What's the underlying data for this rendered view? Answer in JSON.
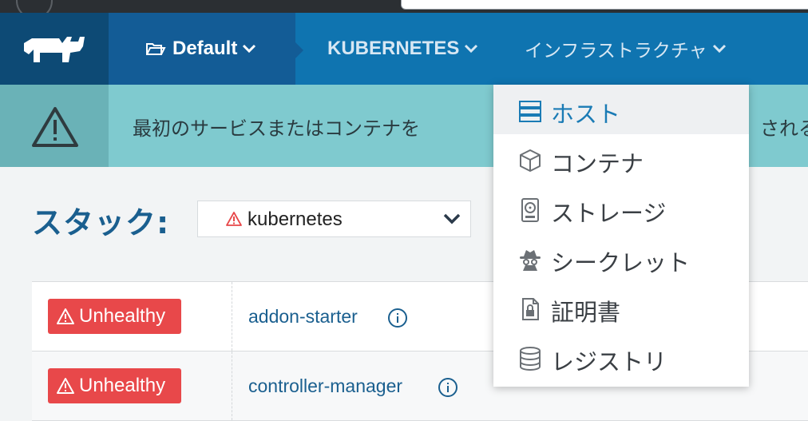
{
  "nav": {
    "environment": "Default",
    "kubernetes": "KUBERNETES",
    "infrastructure": "インフラストラクチャ"
  },
  "banner": {
    "text_left": "最初のサービスまたはコンテナを",
    "text_right": "される"
  },
  "stack": {
    "label": "スタック:",
    "selected": "kubernetes"
  },
  "services": [
    {
      "status": "Unhealthy",
      "name": "addon-starter"
    },
    {
      "status": "Unhealthy",
      "name": "controller-manager"
    }
  ],
  "menu": {
    "items": [
      {
        "label": "ホスト",
        "icon": "server-icon"
      },
      {
        "label": "コンテナ",
        "icon": "cube-icon"
      },
      {
        "label": "ストレージ",
        "icon": "storage-icon"
      },
      {
        "label": "シークレット",
        "icon": "spy-icon"
      },
      {
        "label": "証明書",
        "icon": "lock-certificate-icon"
      },
      {
        "label": "レジストリ",
        "icon": "database-icon"
      }
    ]
  },
  "colors": {
    "nav": "#0f74b0",
    "banner": "#7fcacf",
    "unhealthy": "#e8484a",
    "link": "#1a5f8f"
  }
}
